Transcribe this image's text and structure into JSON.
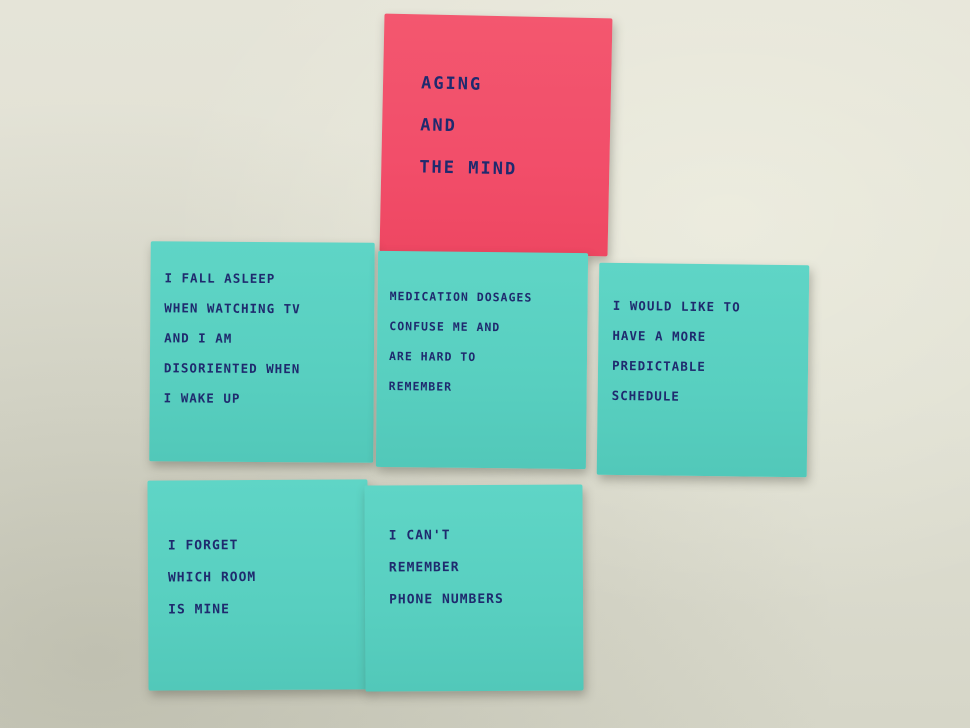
{
  "notes": {
    "title": "AGING\nAND\nTHE MIND",
    "note1": "I FALL ASLEEP\nWHEN WATCHING TV\nAND I AM\nDISORIENTED WHEN\nI WAKE UP",
    "note2": "MEDICATION DOSAGES\nCONFUSE ME AND\nARE HARD TO\nREMEMBER",
    "note3": "I WOULD LIKE TO\nHAVE A MORE\nPREDICTABLE\nSCHEDULE",
    "note4": "I FORGET\nWHICH ROOM\nIS MINE",
    "note5": "I CAN'T\nREMEMBER\nPHONE NUMBERS"
  },
  "colors": {
    "wall": "#dfdfd2",
    "title_note": "#f24e6a",
    "sticky_note": "#58cfc0",
    "ink": "#1f2a6e"
  }
}
